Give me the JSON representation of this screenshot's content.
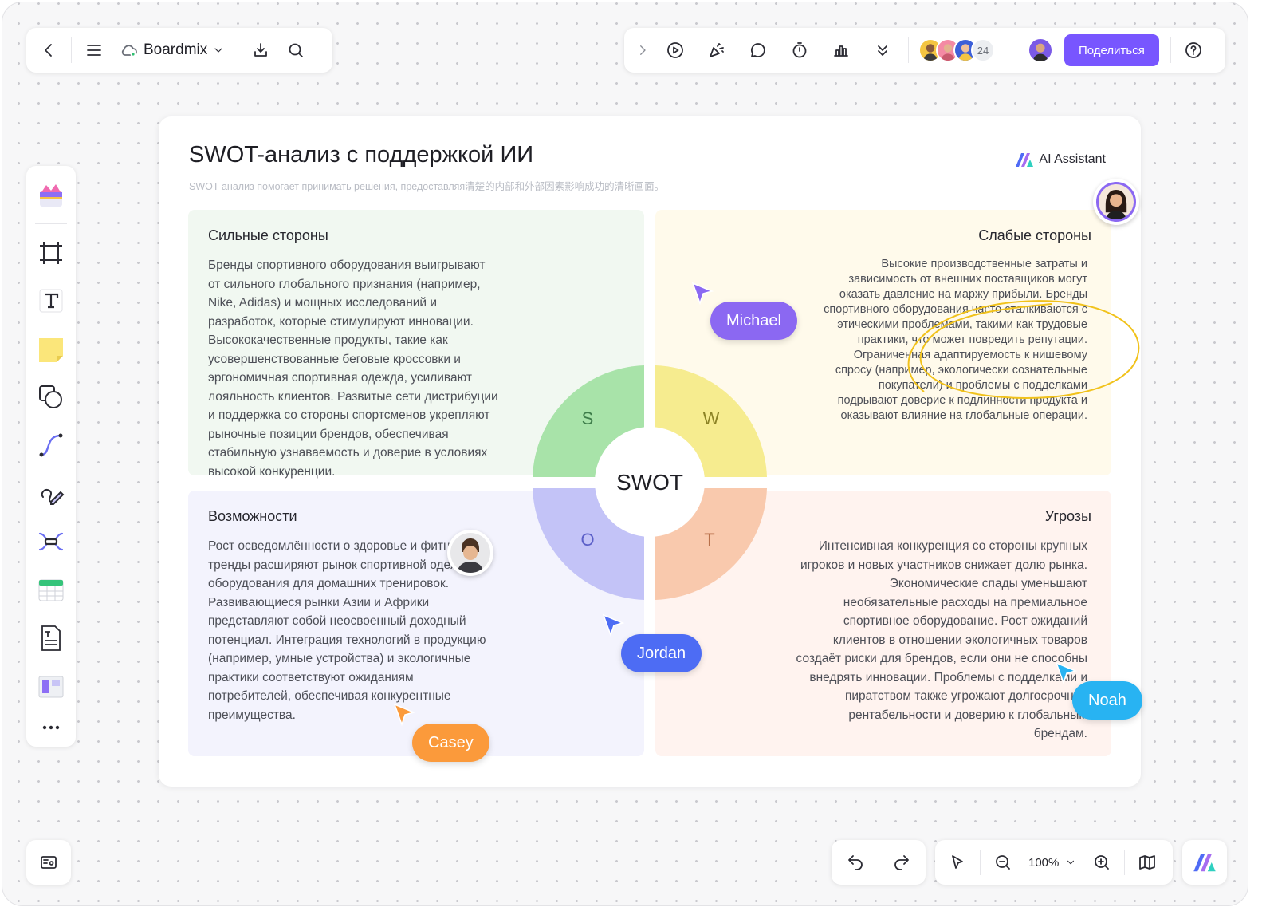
{
  "toolbar": {
    "brand": "Boardmix",
    "share_label": "Поделиться",
    "collaborator_count": "24"
  },
  "card": {
    "title": "SWOT-анализ с поддержкой ИИ",
    "subtitle": "SWOT-анализ помогает принимать решения, предоставляя清楚的内部和外部因素影响成功的清晰画面。",
    "ai_assistant": "AI Assistant"
  },
  "quadrants": {
    "strengths": {
      "title": "Сильные стороны",
      "lines": [
        "Бренды спортивного оборудования выигрывают",
        "от сильного глобального признания (например,",
        "Nike, Adidas) и мощных исследований и",
        "разработок, которые стимулируют инновации.",
        "Высококачественные продукты, такие как",
        "усовершенствованные беговые кроссовки и",
        "эргономичная спортивная одежда, усиливают",
        "лояльность клиентов. Развитые сети дистрибуции",
        "и поддержка со стороны спортсменов укрепляют",
        "рыночные позиции брендов, обеспечивая",
        "стабильную узнаваемость и доверие в условиях",
        "высокой конкуренции."
      ]
    },
    "weaknesses": {
      "title": "Слабые стороны",
      "lines": [
        "Высокие производственные затраты и",
        "зависимость от внешних поставщиков могут",
        "оказать давление на маржу прибыли. Бренды",
        "спортивного оборудования часто сталкиваются с",
        "этическими проблемами, такими как трудовые",
        "практики, что может повредить репутации.",
        "Ограниченная адаптируемость к нишевому",
        "спросу (например, экологически сознательные",
        "покупатели) и проблемы с подделками",
        "подрывают доверие к подлинности продукта и",
        "оказывают влияние на глобальные операции."
      ]
    },
    "opportunities": {
      "title": "Возможности",
      "lines": [
        "Рост осведомлённости о здоровье и фитнесе и",
        "тренды расширяют рынок спортивной одежды и",
        "оборудования для домашних тренировок.",
        "Развивающиеся рынки Азии и Африки",
        "представляют собой неосвоенный доходный",
        "потенциал. Интеграция технологий в продукцию",
        "(например, умные устройства) и экологичные",
        "практики соответствуют ожиданиям",
        "потребителей, обеспечивая конкурентные",
        "преимущества."
      ]
    },
    "threats": {
      "title": "Угрозы",
      "lines": [
        "Интенсивная конкуренция со стороны крупных",
        "игроков и новых участников снижает долю рынка.",
        "Экономические спады уменьшают",
        "необязательные расходы на премиальное",
        "спортивное оборудование. Рост ожиданий",
        "клиентов в отношении экологичных товаров",
        "создаёт риски для брендов, если они не способны",
        "внедрять инновации. Проблемы с подделками и",
        "пиратством также угрожают долгосрочной",
        "рентабельности и доверию к глобальным",
        "брендам."
      ]
    }
  },
  "swot": {
    "center": "SWOT",
    "s": "S",
    "w": "W",
    "o": "O",
    "t": "T",
    "colors": {
      "s": "#a8e3a9",
      "w": "#f6ec8f",
      "o": "#c3c3f7",
      "t": "#f9c9ad"
    }
  },
  "cursors": {
    "michael": {
      "name": "Michael",
      "color": "#8b68f2"
    },
    "jordan": {
      "name": "Jordan",
      "color": "#4d6cf4"
    },
    "casey": {
      "name": "Casey",
      "color": "#fb9a3b"
    },
    "noah": {
      "name": "Noah",
      "color": "#28b3f2"
    }
  },
  "zoom": {
    "level": "100%"
  },
  "colors": {
    "accent": "#7856ff"
  }
}
